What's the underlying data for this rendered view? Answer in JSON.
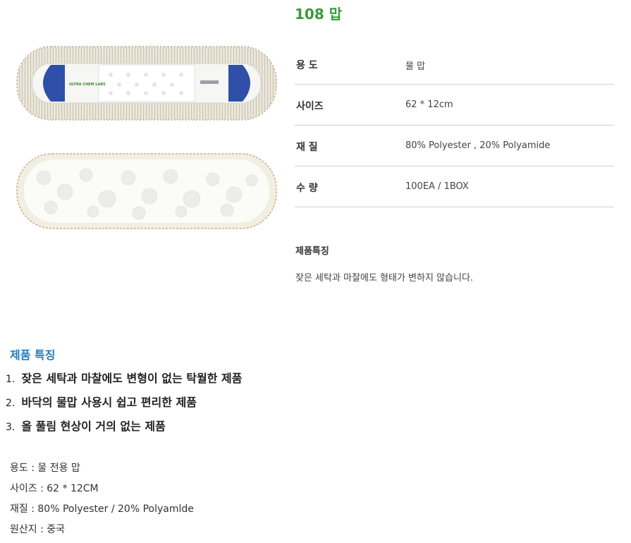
{
  "product": {
    "title": "108 맙"
  },
  "images": [
    {
      "name": "mop-top-view",
      "label": "ULTRA CHEM LABS"
    },
    {
      "name": "mop-bottom-view"
    }
  ],
  "specs": [
    {
      "label": "용  도",
      "value": "물 맙"
    },
    {
      "label": "사이즈",
      "value": "62 * 12cm"
    },
    {
      "label": "재  질",
      "value": "80% Polyester , 20% Polyamide"
    },
    {
      "label": "수  량",
      "value": "100EA / 1BOX"
    }
  ],
  "feature": {
    "heading": "제품특징",
    "text": "잦은 세탁과 마찰에도 형태가 변하지 않습니다."
  },
  "section": {
    "title": "제품 특징",
    "items": [
      {
        "num": "1.",
        "text": "잦은 세탁과 마찰에도 변형이 없는 탁월한 제품"
      },
      {
        "num": "2.",
        "text": "바닥의 물맙 사용시 쉽고 편리한 제품"
      },
      {
        "num": "3.",
        "text": "올 풀림 현상이 거의 없는 제품"
      }
    ]
  },
  "info": [
    "용도 : 물 전용 맙",
    "사이즈 : 62 * 12CM",
    "재질 : 80% Polyester / 20% Polyamlde",
    "원산지 : 중국"
  ],
  "colors": {
    "title_green": "#3a9a3a",
    "section_blue": "#1f7cc2",
    "mop_pad_blue": "#2f4fa8"
  }
}
